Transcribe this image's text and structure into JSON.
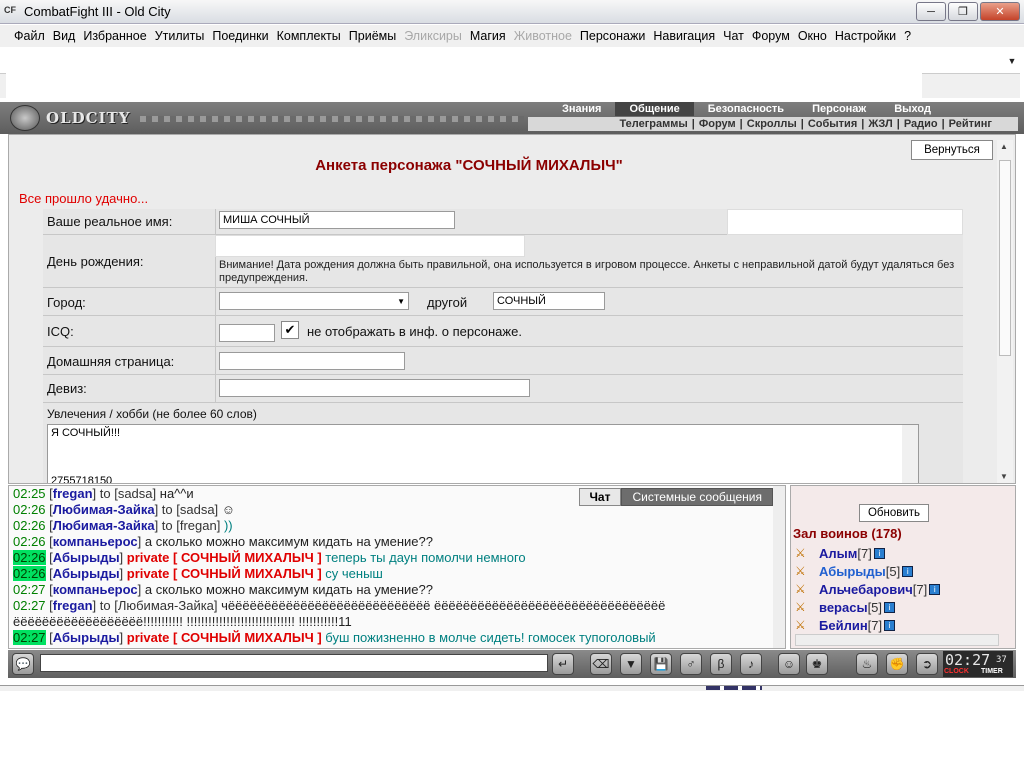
{
  "window": {
    "app_icon": "CF",
    "title": "CombatFight III - Old City"
  },
  "menu": [
    "Файл",
    "Вид",
    "Избранное",
    "Утилиты",
    "Поединки",
    "Комплекты",
    "Приёмы",
    "Эликсиры",
    "Магия",
    "Животное",
    "Персонажи",
    "Навигация",
    "Чат",
    "Форум",
    "Окно",
    "Настройки",
    "?"
  ],
  "menu_disabled": [
    "Эликсиры",
    "Животное"
  ],
  "game": {
    "logo": "OLDCITY",
    "top_tabs": [
      "Знания",
      "Общение",
      "Безопасность",
      "Персонаж",
      "Выход"
    ],
    "active_tab": "Общение",
    "sub_links": [
      "Телеграммы",
      "Форум",
      "Скроллы",
      "События",
      "ЖЗЛ",
      "Радио",
      "Рейтинг"
    ]
  },
  "form": {
    "back_label": "Вернуться",
    "title": "Анкета персонажа \"СОЧНЫЙ МИХАЛЫЧ\"",
    "ok_message": "Все прошло удачно...",
    "real_name_label": "Ваше реальное имя:",
    "real_name_value": "МИША СОЧНЫЙ",
    "birthday_label": "День рождения:",
    "birthday_warning": "Внимание! Дата рождения должна быть правильной, она используется в игровом процессе. Анкеты с неправильной датой будут удаляться без предупреждения.",
    "city_label": "Город:",
    "city_other_label": "другой",
    "city_other_value": "СОЧНЫЙ",
    "icq_label": "ICQ:",
    "icq_hide_label": "не отображать в инф. о персонаже.",
    "homepage_label": "Домашняя страница:",
    "motto_label": "Девиз:",
    "hobby_label": "Увлечения / хобби (не более 60 слов)",
    "hobby_line1": "Я СОЧНЫЙ!!!",
    "hobby_line2": "2755718150"
  },
  "chat": {
    "tabs": {
      "chat": "Чат",
      "system": "Системные сообщения"
    },
    "lines": [
      {
        "time": "02:25",
        "hl": false,
        "nick": "fregan",
        "to": "to [sadsa]",
        "msg": "на^^и",
        "plain": true
      },
      {
        "time": "02:26",
        "hl": false,
        "nick": "Любимая-Зайка",
        "to": "to [sadsa]",
        "msg": "☺",
        "plain": true
      },
      {
        "time": "02:26",
        "hl": false,
        "nick": "Любимая-Зайка",
        "to": "to [fregan]",
        "msg": "))",
        "plain": false
      },
      {
        "time": "02:26",
        "hl": false,
        "nick": "компаньерос",
        "to": "",
        "msg": "а сколько можно максимум кидать на умение??",
        "plain": true
      },
      {
        "time": "02:26",
        "hl": true,
        "nick": "Абырыды",
        "private": "private [ СОЧНЫЙ МИХАЛЫЧ ]",
        "msg": "теперь ты даун помолчи немного",
        "plain": false
      },
      {
        "time": "02:26",
        "hl": true,
        "nick": "Абырыды",
        "private": "private [ СОЧНЫЙ МИХАЛЫЧ ]",
        "msg": "су ченыш",
        "plain": false
      },
      {
        "time": "02:27",
        "hl": false,
        "nick": "компаньерос",
        "to": "",
        "msg": "а сколько можно максимум кидать на умение??",
        "plain": true
      },
      {
        "time": "02:27",
        "hl": false,
        "nick": "fregan",
        "to": "to [Любимая-Зайка]",
        "msg": "чёёёёёёёёёёёёёёёёёёёёёёёёёёёё ёёёёёёёёёёёёёёёёёёёёёёёёёёёёёёёё",
        "plain": true
      },
      {
        "time": "",
        "hl": false,
        "nick": "",
        "to": "",
        "msg": "ёёёёёёёёёёёёёёёёёё!!!!!!!!!!! !!!!!!!!!!!!!!!!!!!!!!!!!!!!!! !!!!!!!!!!!11",
        "plain": true
      },
      {
        "time": "02:27",
        "hl": true,
        "nick": "Абырыды",
        "private": "private [ СОЧНЫЙ МИХАЛЫЧ ]",
        "msg": "буш пожизненно в молче сидеть! гомосек тупоголовый",
        "plain": false
      }
    ]
  },
  "players": {
    "refresh_label": "Обновить",
    "hall_label": "Зал воинов (178)",
    "list": [
      {
        "name": "Алым",
        "level": "[7]",
        "me": false
      },
      {
        "name": "Абырыды",
        "level": "[5]",
        "me": true
      },
      {
        "name": "Альчебарович",
        "level": "[7]",
        "me": false
      },
      {
        "name": "верасы",
        "level": "[5]",
        "me": false
      },
      {
        "name": "Бейлин",
        "level": "[7]",
        "me": false
      }
    ]
  },
  "clock": {
    "time": "02:27",
    "seconds": "37",
    "clock_label": "CLOCK",
    "timer_label": "TIMER"
  }
}
